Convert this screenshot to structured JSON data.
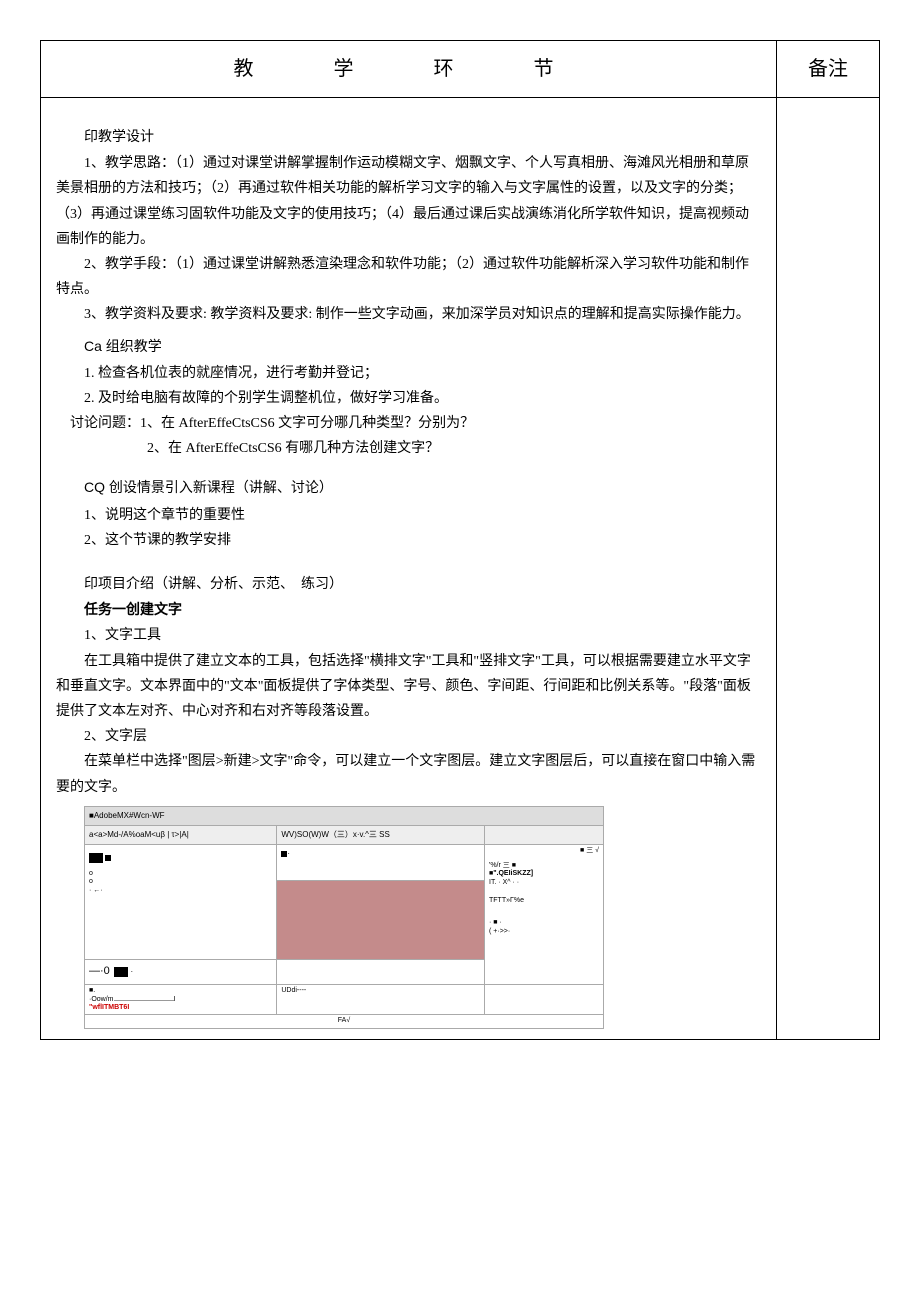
{
  "header": {
    "main": "教　学　环　节",
    "note": "备注"
  },
  "sections": {
    "design_title": "印教学设计",
    "design_p1": "1、教学思路：（1）通过对课堂讲解掌握制作运动模糊文字、烟飘文字、个人写真相册、海滩风光相册和草原美景相册的方法和技巧；（2）再通过软件相关功能的解析学习文字的输入与文字属性的设置，以及文字的分类；（3）再通过课堂练习固软件功能及文字的使用技巧；（4）最后通过课后实战演练消化所学软件知识，提高视频动画制作的能力。",
    "design_p2": "2、教学手段：（1）通过课堂讲解熟悉渲染理念和软件功能；（2）通过软件功能解析深入学习软件功能和制作特点。",
    "design_p3": "3、教学资料及要求: 教学资料及要求: 制作一些文字动画，来加深学员对知识点的理解和提高实际操作能力。",
    "org_title": "Ca 组织教学",
    "org_p1": "1. 检查各机位表的就座情况，进行考勤并登记；",
    "org_p2": "2. 及时给电脑有故障的个别学生调整机位，做好学习准备。",
    "discuss_label": "讨论问题：1、在 AfterEffeCtsCS6 文字可分哪几种类型？分别为？",
    "discuss_q2": "2、在 AfterEffeCtsCS6 有哪几种方法创建文字？",
    "cq_title": "CQ 创设情景引入新课程（讲解、讨论）",
    "cq_p1": "1、说明这个章节的重要性",
    "cq_p2": "2、这个节课的教学安排",
    "proj_title": "印项目介绍（讲解、分析、示范、　练习）",
    "task_title": "任务一创建文字",
    "task_p1": "1、文字工具",
    "task_p1_body": "在工具箱中提供了建立文本的工具，包括选择\"横排文字\"工具和\"竖排文字\"工具，可以根据需要建立水平文字和垂直文字。文本界面中的\"文本\"面板提供了字体类型、字号、颜色、字间距、行间距和比例关系等。\"段落\"面板提供了文本左对齐、中心对齐和右对齐等段落设置。",
    "task_p2": "2、文字层",
    "task_p2_body": "在菜单栏中选择\"图层>新建>文字\"命令，可以建立一个文字图层。建立文字图层后，可以直接在窗口中输入需要的文字。"
  },
  "screenshot": {
    "titlebar": "■AdobeMX#Wcn-WF",
    "menubar": "a<a>Md-/A%oaM<uβ | τ>|A|",
    "viewport_label": "WV)SO(W)W（三）x·v.^三 SS",
    "footer_left": "·Oow/m",
    "footer_label2": "\"wflITMBT6I",
    "footer_mid": "UDdi----",
    "footer_bottom": "FA√",
    "zero_label": "—·0",
    "side": {
      "l1": "■ 三 √",
      "l2": "'%/r 三 ■",
      "l3": "■\".QEIiSKZZ]",
      "l4": "IT.  · X^ · ·",
      "l5": "TFTT»Γ%e",
      "l6": "· ■ ·",
      "l7": "(  +·>>·"
    }
  }
}
